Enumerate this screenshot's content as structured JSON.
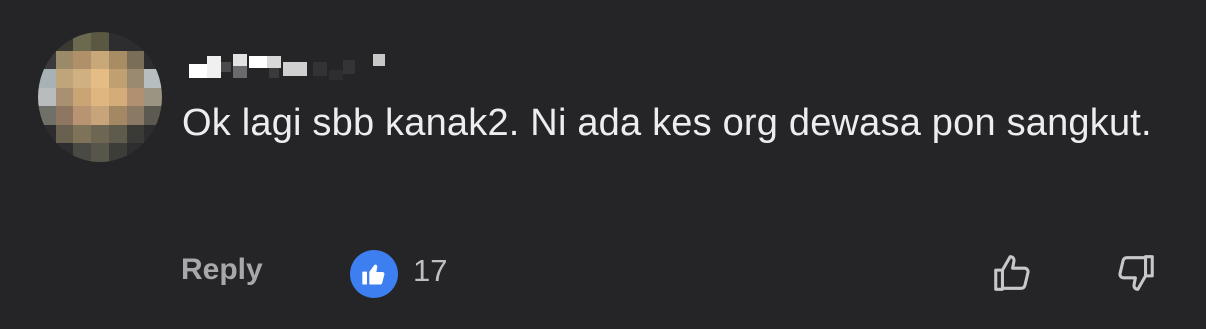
{
  "comment": {
    "author_name_redacted": "",
    "text": "Ok lagi sbb kanak2. Ni ada kes org dewasa pon sangkut.",
    "reply_label": "Reply",
    "like_count": "17"
  },
  "icons": {
    "like_badge": "thumbs-up-icon",
    "upvote": "thumbs-up-outline-icon",
    "downvote": "thumbs-down-outline-icon"
  },
  "colors": {
    "background": "#252527",
    "like_badge": "#3d7ef0",
    "text": "#ededef",
    "muted": "#a8a8ac"
  }
}
